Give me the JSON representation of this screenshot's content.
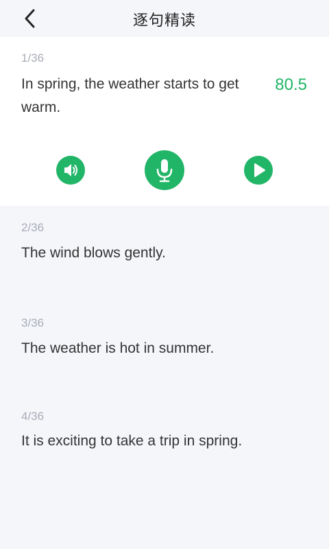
{
  "header": {
    "title": "逐句精读"
  },
  "sentences": [
    {
      "index": "1/36",
      "text": "In spring, the weather starts to get warm.",
      "score": "80.5"
    },
    {
      "index": "2/36",
      "text": "The wind blows gently."
    },
    {
      "index": "3/36",
      "text": "The weather is hot in summer."
    },
    {
      "index": "4/36",
      "text": "It is exciting to take a trip in spring."
    }
  ],
  "controls": {
    "icons": [
      "speaker-icon",
      "microphone-icon",
      "play-icon"
    ]
  },
  "colors": {
    "accent": "#21b567",
    "background": "#f5f6fa",
    "card": "#ffffff",
    "index_text": "#a8acb6",
    "sentence_text": "#333333"
  }
}
